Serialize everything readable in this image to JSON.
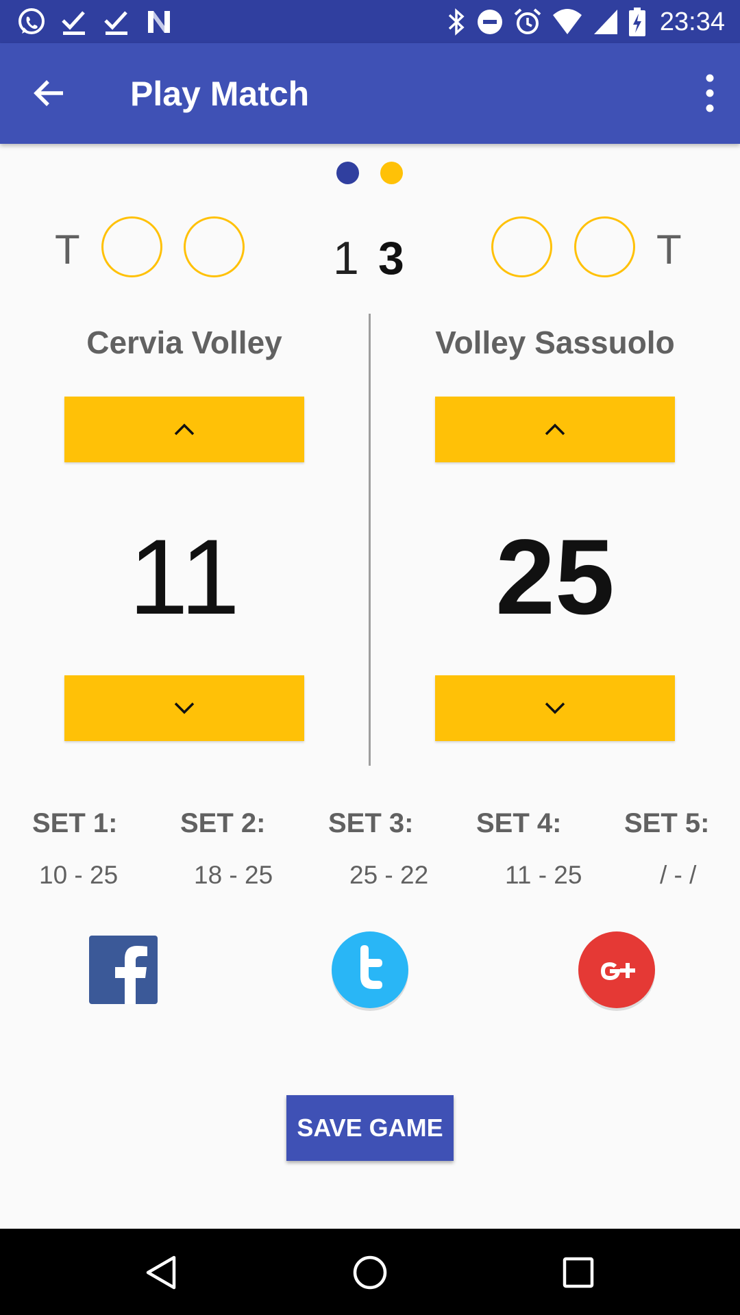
{
  "status_bar": {
    "left_icons": [
      "whatsapp-icon",
      "check-icon",
      "check-icon",
      "n-icon"
    ],
    "right_icons": [
      "bluetooth-icon",
      "do-not-disturb-icon",
      "alarm-icon",
      "wifi-icon",
      "signal-icon",
      "battery-charging-icon"
    ],
    "time": "23:34"
  },
  "app_bar": {
    "title": "Play Match"
  },
  "page_indicator": {
    "pages": 2,
    "active_colors": [
      "#303f9f",
      "#ffc107"
    ]
  },
  "scoreboard": {
    "left_timeout_label": "T",
    "right_timeout_label": "T",
    "sets_won_left": "1",
    "sets_won_right": "3"
  },
  "teams": [
    {
      "name": "Cervia Volley",
      "score": "11"
    },
    {
      "name": "Volley Sassuolo",
      "score": "25"
    }
  ],
  "sets": [
    {
      "label": "SET 1:",
      "score": "10 - 25"
    },
    {
      "label": "SET 2:",
      "score": "18 - 25"
    },
    {
      "label": "SET 3:",
      "score": "25 - 22"
    },
    {
      "label": "SET 4:",
      "score": "11 - 25"
    },
    {
      "label": "SET 5:",
      "score": "/ - /"
    }
  ],
  "social": [
    "facebook-icon",
    "twitter-icon",
    "google-plus-icon"
  ],
  "save_button": "SAVE GAME",
  "nav": [
    "back-icon",
    "home-icon",
    "recents-icon"
  ],
  "colors": {
    "primary": "#3f51b5",
    "primary_dark": "#303f9f",
    "accent": "#ffc107"
  }
}
